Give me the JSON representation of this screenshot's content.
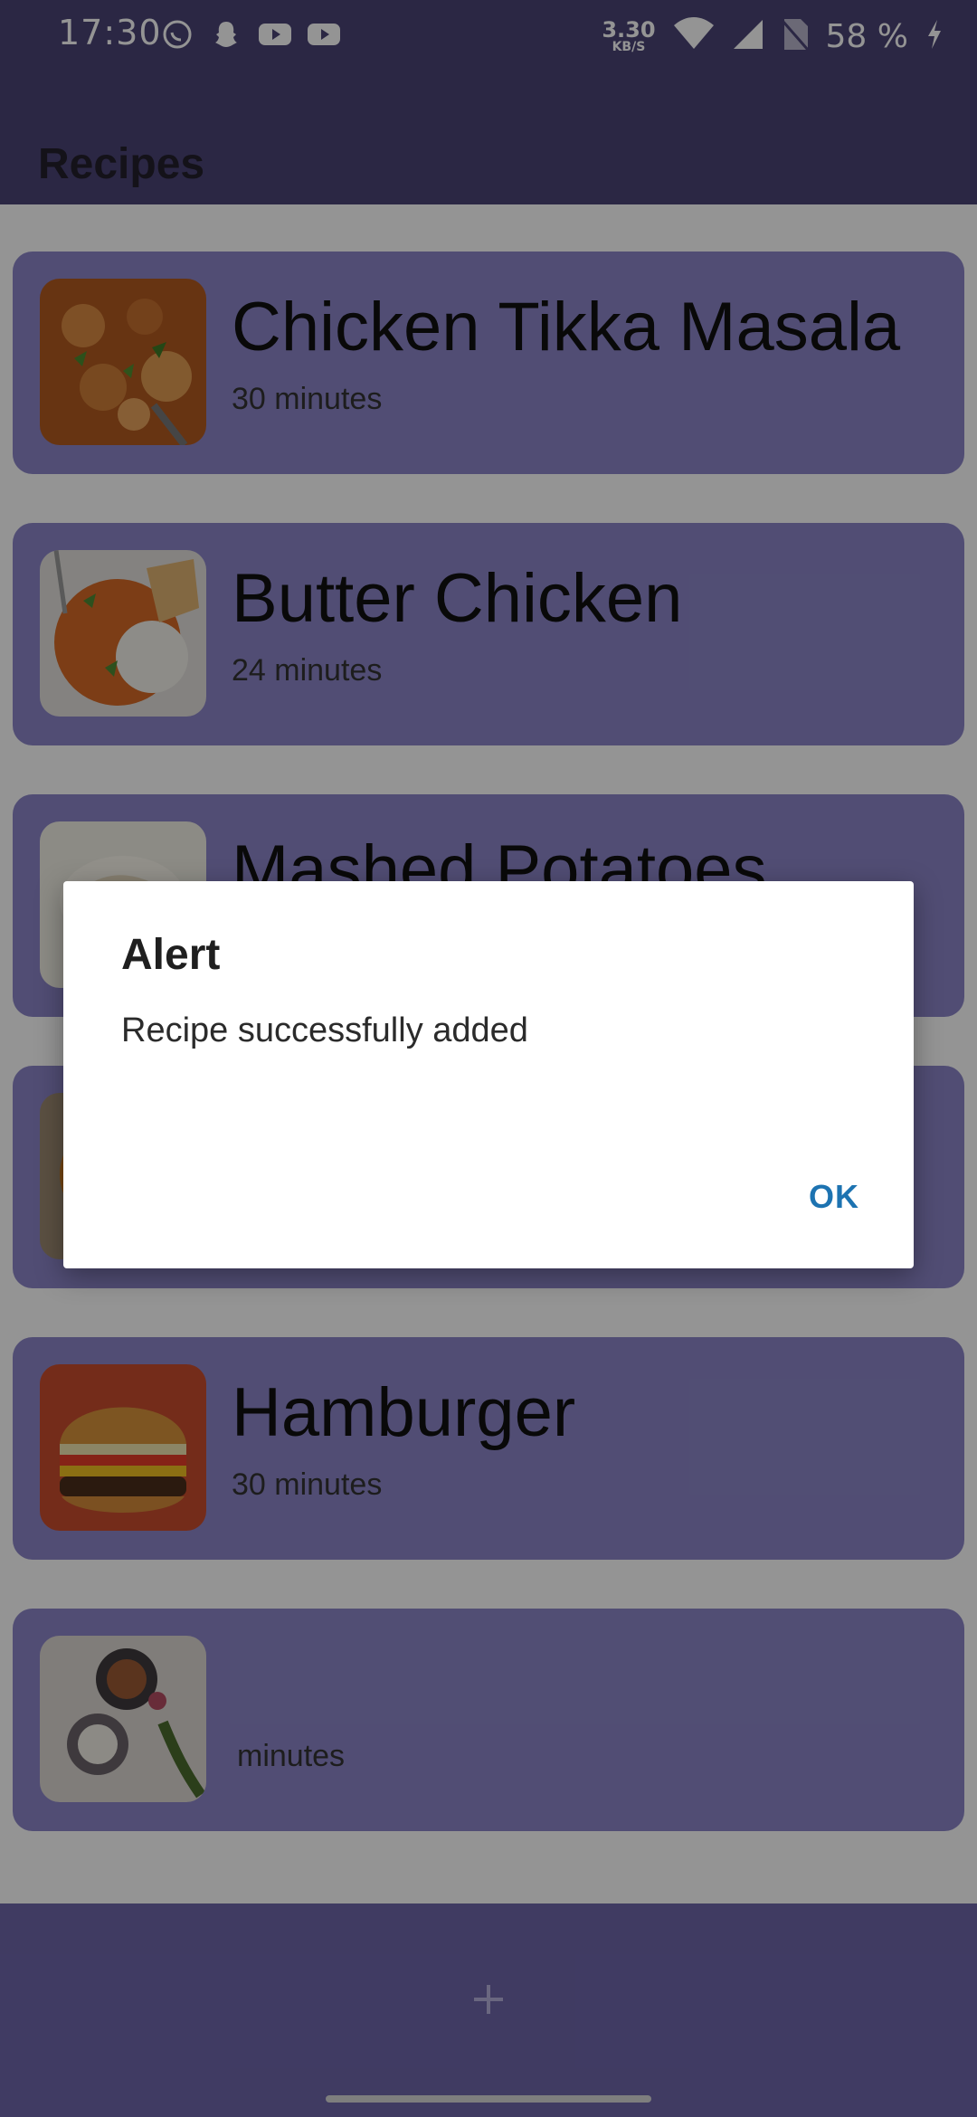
{
  "status_bar": {
    "time": "17:30",
    "net_speed_value": "3.30",
    "net_speed_unit": "KB/S",
    "battery": "58 %"
  },
  "app": {
    "title": "Recipes"
  },
  "recipes": [
    {
      "name": "Chicken Tikka Masala",
      "time": "30 minutes",
      "image": "chicken-tikka-photo"
    },
    {
      "name": "Butter Chicken",
      "time": "24 minutes",
      "image": "butter-chicken-photo"
    },
    {
      "name": "Mashed Potatoes",
      "time": "",
      "image": "mashed-potatoes-photo"
    },
    {
      "name": "",
      "time": "",
      "image": "curry-photo"
    },
    {
      "name": "Hamburger",
      "time": "30 minutes",
      "image": "hamburger-photo"
    },
    {
      "name": "",
      "time": "minutes",
      "image": "ingredients-photo"
    }
  ],
  "dialog": {
    "title": "Alert",
    "message": "Recipe successfully added",
    "ok_label": "OK"
  },
  "bottom_bar": {
    "add_icon": "plus-icon"
  },
  "colors": {
    "app_bar": "#4b4476",
    "card": "#8c86c8",
    "bottom_bar": "#6e66aa",
    "dialog_button": "#1d73b1"
  }
}
